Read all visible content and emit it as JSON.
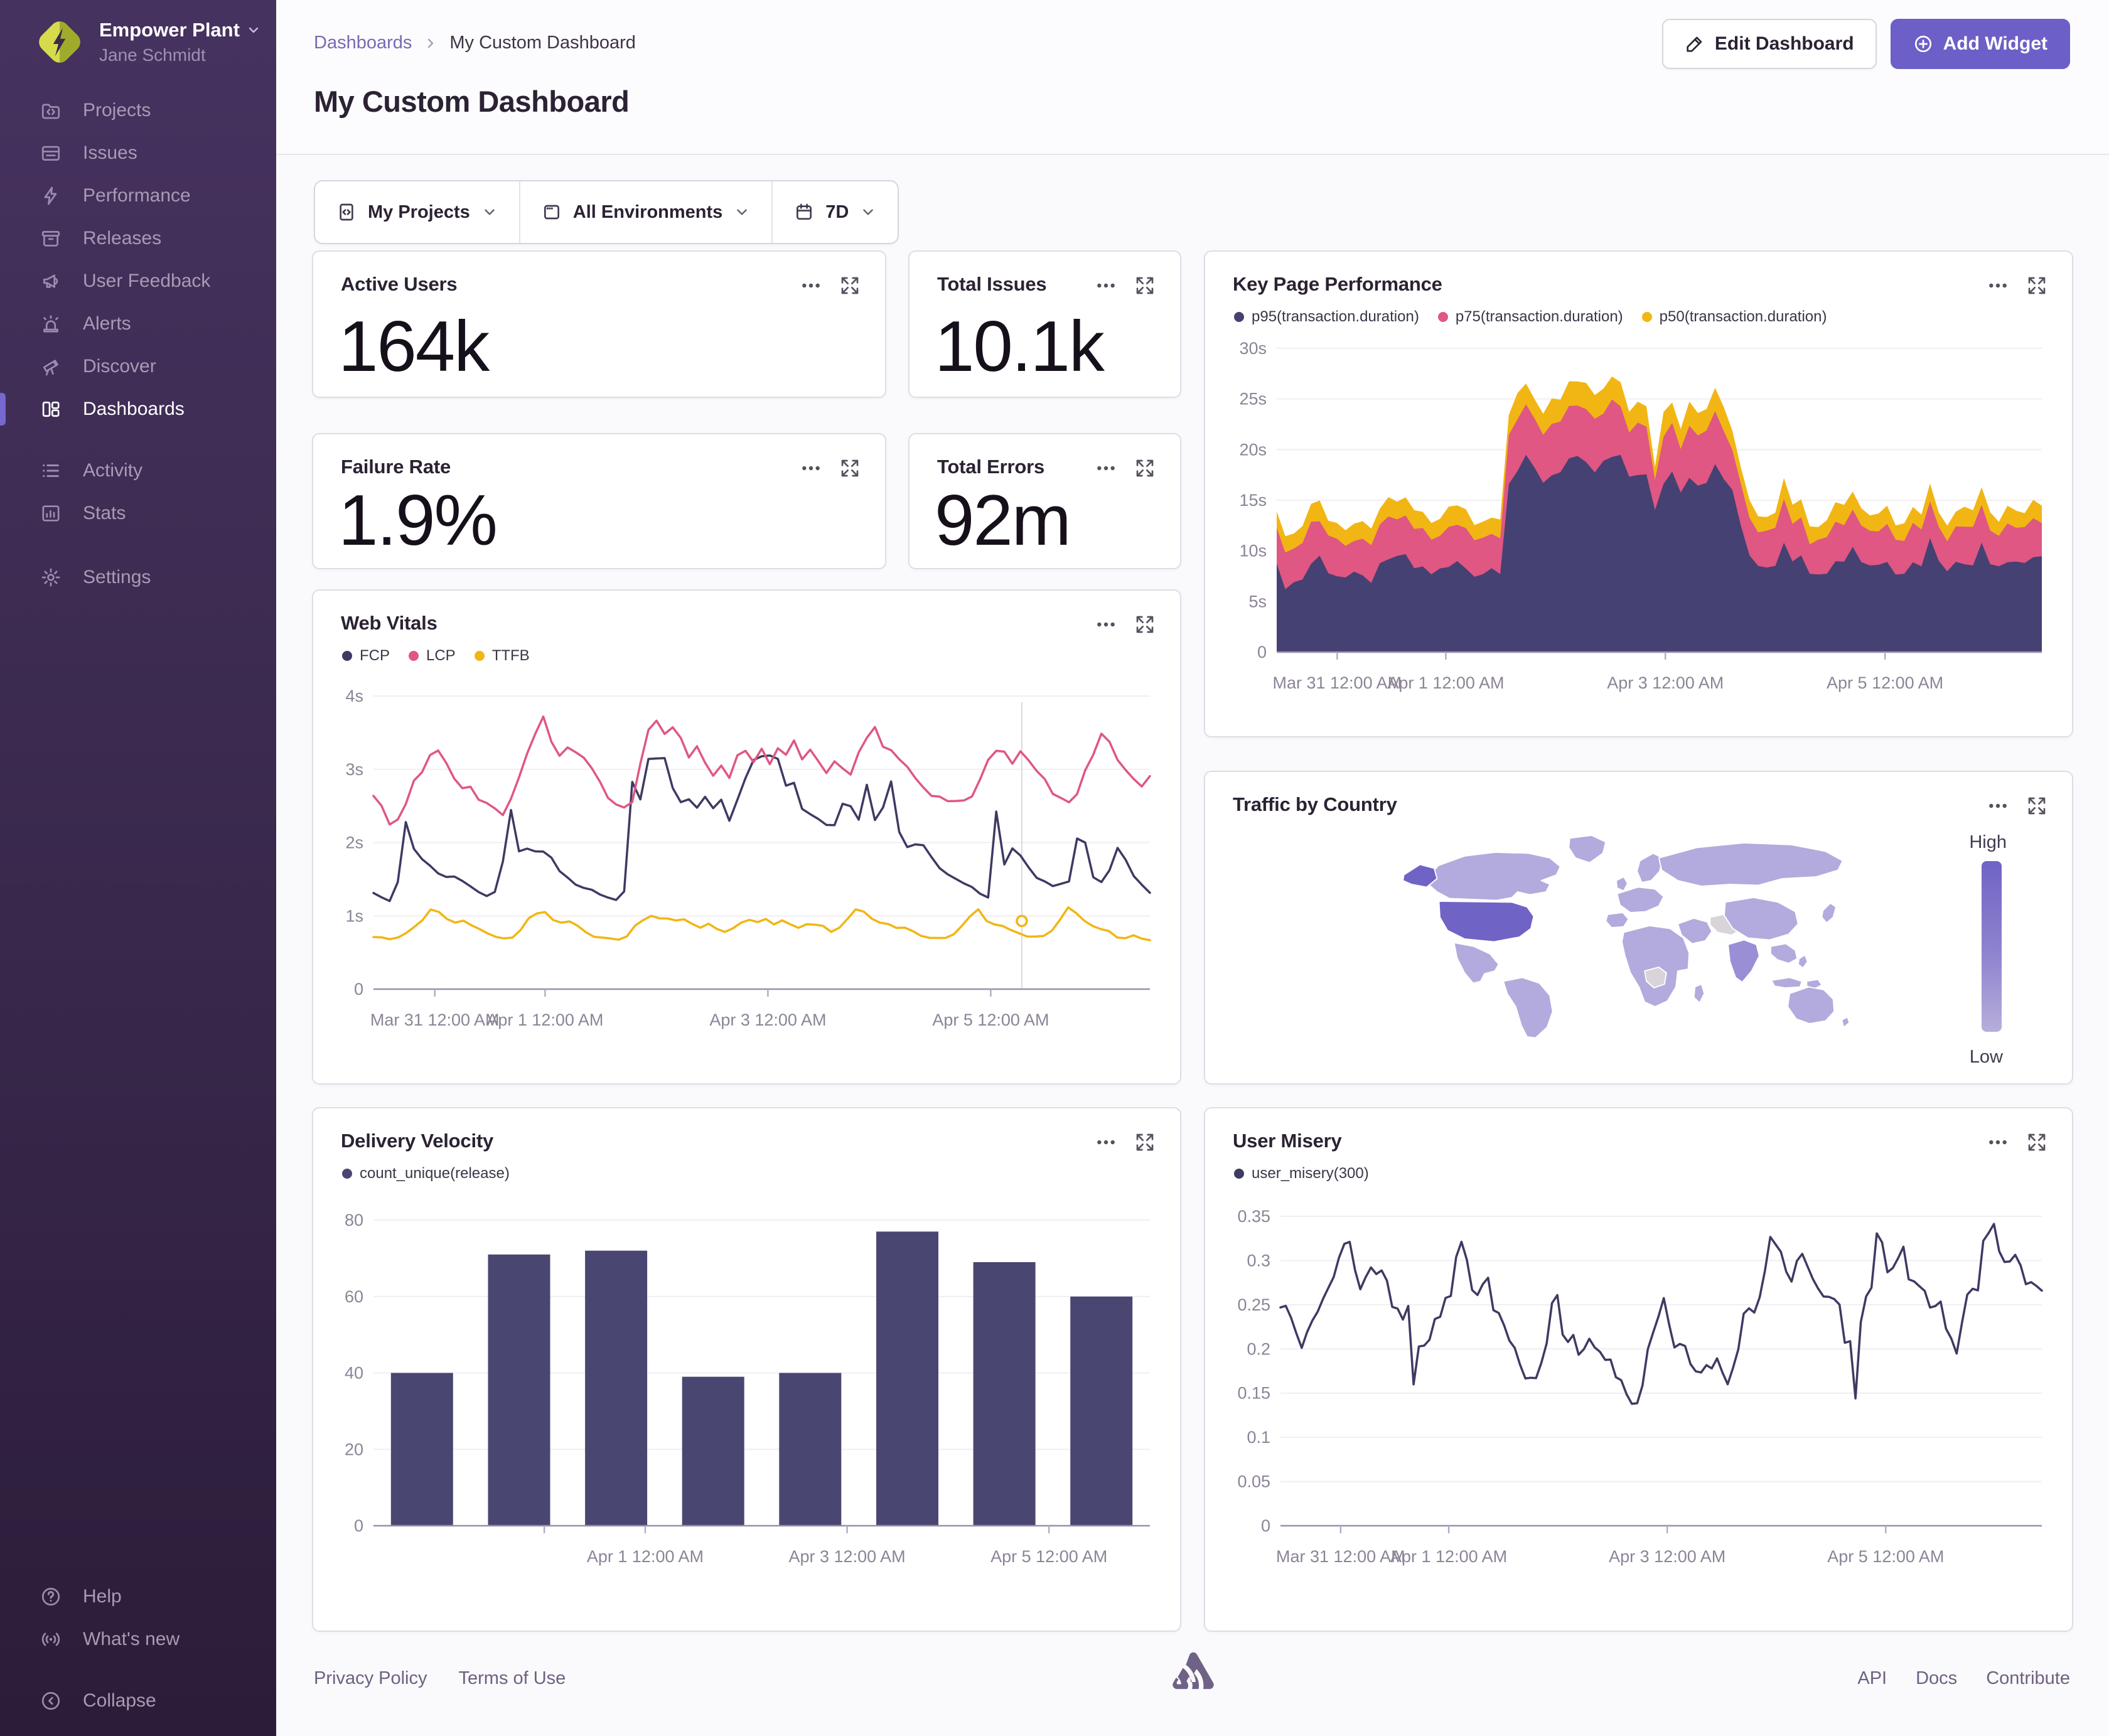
{
  "org": {
    "name": "Empower Plant",
    "user": "Jane Schmidt"
  },
  "sidebar": {
    "items": [
      {
        "label": "Projects",
        "icon": "projects-icon"
      },
      {
        "label": "Issues",
        "icon": "issues-icon"
      },
      {
        "label": "Performance",
        "icon": "performance-icon"
      },
      {
        "label": "Releases",
        "icon": "releases-icon"
      },
      {
        "label": "User Feedback",
        "icon": "user-feedback-icon"
      },
      {
        "label": "Alerts",
        "icon": "alerts-icon"
      },
      {
        "label": "Discover",
        "icon": "discover-icon"
      },
      {
        "label": "Dashboards",
        "icon": "dashboards-icon",
        "active": true
      },
      {
        "label": "Activity",
        "icon": "activity-icon"
      },
      {
        "label": "Stats",
        "icon": "stats-icon"
      },
      {
        "label": "Settings",
        "icon": "settings-icon"
      }
    ],
    "footer_items": [
      {
        "label": "Help",
        "icon": "help-icon"
      },
      {
        "label": "What's new",
        "icon": "broadcast-icon"
      },
      {
        "label": "Collapse",
        "icon": "collapse-icon"
      }
    ]
  },
  "breadcrumb": {
    "parent": "Dashboards",
    "current": "My Custom Dashboard"
  },
  "page_title": "My Custom Dashboard",
  "actions": {
    "edit": "Edit Dashboard",
    "add": "Add Widget"
  },
  "filters": {
    "projects": "My Projects",
    "environments": "All Environments",
    "date": "7D"
  },
  "widgets": {
    "stats": [
      {
        "title": "Active Users",
        "value": "164k"
      },
      {
        "title": "Total Issues",
        "value": "10.1k"
      },
      {
        "title": "Failure Rate",
        "value": "1.9%"
      },
      {
        "title": "Total Errors",
        "value": "92m"
      }
    ]
  },
  "map_legend": {
    "high": "High",
    "low": "Low"
  },
  "footer": {
    "privacy": "Privacy Policy",
    "terms": "Terms of Use",
    "api": "API",
    "docs": "Docs",
    "contribute": "Contribute"
  },
  "colors": {
    "accent": "#6C5FC7",
    "navy": "#454173",
    "pink": "#DF5782",
    "yellow": "#F1B613"
  },
  "chart_data": [
    {
      "type": "area",
      "stacked": true,
      "title": "Key Page Performance",
      "ylim": [
        0,
        30
      ],
      "yticks": [
        {
          "v": 0,
          "t": "0"
        },
        {
          "v": 5,
          "t": "5s"
        },
        {
          "v": 10,
          "t": "10s"
        },
        {
          "v": 15,
          "t": "15s"
        },
        {
          "v": 20,
          "t": "20s"
        },
        {
          "v": 25,
          "t": "25s"
        },
        {
          "v": 30,
          "t": "30s"
        }
      ],
      "xticks": [
        {
          "f": 0.079,
          "t": "Mar 31 12:00 AM"
        },
        {
          "f": 0.221,
          "t": "Apr 1 12:00 AM"
        },
        {
          "f": 0.508,
          "t": "Apr 3 12:00 AM"
        },
        {
          "f": 0.795,
          "t": "Apr 5 12:00 AM"
        }
      ],
      "series": [
        {
          "name": "p95(transaction.duration)",
          "color": "#454173",
          "jitter": 0.9,
          "values": [
            8.0,
            7.0,
            6.8,
            7.4,
            8.8,
            9.3,
            8.4,
            7.8,
            7.3,
            7.1,
            7.0,
            7.4,
            7.9,
            8.6,
            9.6,
            8.9,
            8.4,
            8.2,
            8.0,
            7.8,
            8.3,
            8.7,
            8.4,
            8.1,
            8.0,
            8.3,
            8.6,
            17.2,
            18.0,
            18.6,
            17.8,
            17.1,
            17.6,
            18.3,
            19.0,
            18.5,
            18.0,
            17.8,
            18.4,
            19.1,
            18.7,
            17.4,
            18.0,
            17.2,
            13.5,
            17.0,
            17.8,
            16.4,
            17.9,
            16.8,
            17.4,
            18.0,
            17.0,
            16.2,
            11.8,
            9.6,
            9.0,
            8.7,
            9.1,
            11.4,
            9.7,
            9.0,
            8.6,
            8.4,
            8.5,
            8.8,
            9.4,
            10.6,
            9.2,
            8.8,
            8.6,
            9.5,
            8.5,
            8.3,
            8.7,
            9.1,
            10.9,
            9.6,
            8.8,
            8.5,
            8.8,
            9.3,
            11.2,
            9.4,
            8.7,
            8.9,
            9.2,
            8.9,
            8.6,
            8.9
          ]
        },
        {
          "name": "p75(transaction.duration)",
          "color": "#DF5782",
          "jitter": 0.45,
          "values": [
            3.4,
            3.6,
            3.3,
            3.5,
            3.9,
            3.7,
            3.5,
            3.4,
            3.3,
            3.2,
            3.3,
            3.5,
            3.8,
            4.0,
            3.7,
            3.6,
            3.5,
            3.4,
            3.6,
            3.5,
            3.7,
            3.8,
            3.6,
            3.5,
            3.4,
            3.6,
            3.7,
            4.8,
            5.2,
            5.0,
            4.7,
            4.9,
            5.3,
            5.1,
            4.8,
            5.0,
            5.2,
            4.9,
            5.1,
            5.3,
            5.0,
            4.6,
            5.0,
            4.4,
            3.0,
            4.8,
            5.0,
            4.5,
            4.9,
            4.6,
            4.8,
            5.0,
            4.6,
            4.3,
            3.8,
            3.5,
            3.4,
            3.3,
            3.5,
            3.9,
            3.6,
            3.4,
            3.3,
            3.2,
            3.3,
            3.5,
            3.7,
            3.9,
            3.5,
            3.4,
            3.3,
            3.6,
            3.4,
            3.3,
            3.5,
            3.6,
            3.9,
            3.6,
            3.4,
            3.3,
            3.5,
            3.7,
            4.0,
            3.6,
            3.4,
            3.5,
            3.6,
            3.5,
            3.4,
            3.5
          ]
        },
        {
          "name": "p50(transaction.duration)",
          "color": "#F1B613",
          "jitter": 0.3,
          "values": [
            1.7,
            1.6,
            1.5,
            1.6,
            1.9,
            1.8,
            1.7,
            1.6,
            1.5,
            1.5,
            1.6,
            1.7,
            1.8,
            2.0,
            1.8,
            1.7,
            1.7,
            1.6,
            1.7,
            1.6,
            1.8,
            1.8,
            1.7,
            1.6,
            1.6,
            1.7,
            1.8,
            2.2,
            2.4,
            2.3,
            2.1,
            2.2,
            2.5,
            2.3,
            2.2,
            2.3,
            2.4,
            2.2,
            2.3,
            2.5,
            2.3,
            2.1,
            2.3,
            2.0,
            1.4,
            2.2,
            2.3,
            2.0,
            2.2,
            2.1,
            2.2,
            2.3,
            2.1,
            2.0,
            1.8,
            1.7,
            1.6,
            1.6,
            1.7,
            1.9,
            1.7,
            1.6,
            1.6,
            1.5,
            1.6,
            1.7,
            1.8,
            1.9,
            1.7,
            1.6,
            1.6,
            1.7,
            1.6,
            1.6,
            1.7,
            1.7,
            1.9,
            1.7,
            1.6,
            1.6,
            1.7,
            1.8,
            1.9,
            1.7,
            1.6,
            1.7,
            1.7,
            1.6,
            1.6,
            1.7
          ]
        }
      ]
    },
    {
      "type": "line",
      "title": "Web Vitals",
      "ylim": [
        0,
        4
      ],
      "yticks": [
        {
          "v": 0,
          "t": "0"
        },
        {
          "v": 1,
          "t": "1s"
        },
        {
          "v": 2,
          "t": "2s"
        },
        {
          "v": 3,
          "t": "3s"
        },
        {
          "v": 4,
          "t": "4s"
        }
      ],
      "xticks": [
        {
          "f": 0.079,
          "t": "Mar 31 12:00 AM"
        },
        {
          "f": 0.221,
          "t": "Apr 1 12:00 AM"
        },
        {
          "f": 0.508,
          "t": "Apr 3 12:00 AM"
        },
        {
          "f": 0.795,
          "t": "Apr 5 12:00 AM"
        }
      ],
      "hover": {
        "x": 0.835,
        "y": 0.93
      },
      "series": [
        {
          "name": "FCP",
          "color": "#3D3A63",
          "jitter": 0.05,
          "values": [
            1.3,
            1.25,
            1.2,
            1.45,
            2.25,
            1.95,
            1.75,
            1.65,
            1.6,
            1.55,
            1.5,
            1.45,
            1.4,
            1.3,
            1.28,
            1.3,
            1.7,
            2.4,
            1.9,
            1.95,
            1.85,
            1.9,
            1.75,
            1.6,
            1.5,
            1.45,
            1.4,
            1.35,
            1.3,
            1.25,
            1.2,
            1.35,
            2.85,
            2.6,
            3.1,
            3.15,
            3.15,
            2.7,
            2.6,
            2.55,
            2.5,
            2.65,
            2.45,
            2.55,
            2.3,
            2.6,
            2.9,
            3.15,
            3.15,
            3.15,
            3.1,
            2.75,
            2.8,
            2.5,
            2.35,
            2.3,
            2.25,
            2.2,
            2.5,
            2.45,
            2.3,
            2.75,
            2.35,
            2.45,
            2.8,
            2.1,
            1.95,
            2.0,
            1.95,
            1.8,
            1.65,
            1.55,
            1.5,
            1.45,
            1.35,
            1.3,
            1.28,
            2.45,
            1.75,
            1.9,
            1.8,
            1.65,
            1.55,
            1.5,
            1.45,
            1.4,
            1.5,
            2.05,
            1.95,
            1.55,
            1.45,
            1.65,
            1.95,
            1.75,
            1.55,
            1.4,
            1.3
          ]
        },
        {
          "name": "LCP",
          "color": "#DF5782",
          "jitter": 0.05,
          "values": [
            2.65,
            2.5,
            2.25,
            2.3,
            2.55,
            2.8,
            3.0,
            3.2,
            3.25,
            3.05,
            2.85,
            2.75,
            2.8,
            2.6,
            2.55,
            2.45,
            2.35,
            2.6,
            2.9,
            3.2,
            3.45,
            3.7,
            3.35,
            3.2,
            3.3,
            3.25,
            3.15,
            3.05,
            2.8,
            2.65,
            2.55,
            2.5,
            2.55,
            3.1,
            3.5,
            3.65,
            3.45,
            3.55,
            3.4,
            3.2,
            3.3,
            3.1,
            2.95,
            3.05,
            2.9,
            3.15,
            3.3,
            3.1,
            3.25,
            3.05,
            3.3,
            3.2,
            3.35,
            3.15,
            3.3,
            3.1,
            2.95,
            3.15,
            3.05,
            2.9,
            3.2,
            3.4,
            3.55,
            3.35,
            3.25,
            3.1,
            3.0,
            2.9,
            2.75,
            2.65,
            2.6,
            2.55,
            2.6,
            2.55,
            2.65,
            2.9,
            3.15,
            3.3,
            3.25,
            3.1,
            3.2,
            3.15,
            3.0,
            2.85,
            2.7,
            2.6,
            2.55,
            2.7,
            2.95,
            3.2,
            3.45,
            3.35,
            3.15,
            3.0,
            2.85,
            2.8,
            2.9
          ]
        },
        {
          "name": "TTFB",
          "color": "#F1B613",
          "jitter": 0.02,
          "values": [
            0.72,
            0.7,
            0.68,
            0.7,
            0.75,
            0.85,
            0.95,
            1.08,
            1.05,
            0.95,
            0.9,
            0.92,
            0.88,
            0.8,
            0.75,
            0.72,
            0.7,
            0.72,
            0.8,
            0.95,
            1.05,
            1.04,
            0.95,
            0.9,
            0.92,
            0.85,
            0.78,
            0.72,
            0.7,
            0.68,
            0.66,
            0.72,
            0.85,
            0.95,
            1.0,
            0.97,
            0.95,
            0.93,
            0.95,
            0.9,
            0.85,
            0.88,
            0.82,
            0.78,
            0.85,
            0.92,
            0.95,
            0.93,
            0.95,
            0.9,
            0.92,
            0.88,
            0.85,
            0.9,
            0.88,
            0.85,
            0.8,
            0.82,
            0.95,
            1.08,
            1.05,
            0.95,
            0.9,
            0.88,
            0.85,
            0.82,
            0.78,
            0.72,
            0.7,
            0.68,
            0.7,
            0.75,
            0.85,
            1.0,
            1.08,
            0.95,
            0.88,
            0.85,
            0.8,
            0.75,
            0.72,
            0.7,
            0.72,
            0.78,
            0.95,
            1.1,
            1.02,
            0.95,
            0.88,
            0.82,
            0.78,
            0.72,
            0.7,
            0.72,
            0.7,
            0.68
          ]
        }
      ]
    },
    {
      "type": "map",
      "title": "Traffic by Country",
      "legend": {
        "high": "High",
        "low": "Low"
      },
      "highlight_countries": [
        "United States",
        "Alaska"
      ],
      "mid_countries": [
        "India"
      ],
      "no_data_countries": [
        "Iran",
        "DR Congo"
      ]
    },
    {
      "type": "bar",
      "title": "Delivery Velocity",
      "ylim": [
        0,
        80
      ],
      "yticks": [
        {
          "v": 0,
          "t": "0"
        },
        {
          "v": 20,
          "t": "20"
        },
        {
          "v": 40,
          "t": "40"
        },
        {
          "v": 60,
          "t": "60"
        },
        {
          "v": 80,
          "t": "80"
        }
      ],
      "xticks": [
        {
          "f": 0.22,
          "t": ""
        },
        {
          "f": 0.35,
          "t": "Apr 1 12:00 AM"
        },
        {
          "f": 0.61,
          "t": "Apr 3 12:00 AM"
        },
        {
          "f": 0.87,
          "t": "Apr 5 12:00 AM"
        }
      ],
      "series": [
        {
          "name": "count_unique(release)",
          "color": "#4A4672",
          "values": [
            40,
            71,
            72,
            39,
            40,
            77,
            69,
            60
          ]
        }
      ]
    },
    {
      "type": "line",
      "title": "User Misery",
      "ylim": [
        0,
        0.35
      ],
      "yticks": [
        {
          "v": 0,
          "t": "0"
        },
        {
          "v": 0.05,
          "t": "0.05"
        },
        {
          "v": 0.1,
          "t": "0.1"
        },
        {
          "v": 0.15,
          "t": "0.15"
        },
        {
          "v": 0.2,
          "t": "0.2"
        },
        {
          "v": 0.25,
          "t": "0.25"
        },
        {
          "v": 0.3,
          "t": "0.3"
        },
        {
          "v": 0.35,
          "t": "0.35"
        }
      ],
      "xticks": [
        {
          "f": 0.079,
          "t": "Mar 31 12:00 AM"
        },
        {
          "f": 0.221,
          "t": "Apr 1 12:00 AM"
        },
        {
          "f": 0.508,
          "t": "Apr 3 12:00 AM"
        },
        {
          "f": 0.795,
          "t": "Apr 5 12:00 AM"
        }
      ],
      "series": [
        {
          "name": "user_misery(300)",
          "color": "#3D3A63",
          "jitter": 0.004,
          "values": [
            0.25,
            0.245,
            0.235,
            0.22,
            0.205,
            0.215,
            0.235,
            0.24,
            0.255,
            0.27,
            0.285,
            0.3,
            0.32,
            0.318,
            0.29,
            0.27,
            0.285,
            0.295,
            0.285,
            0.29,
            0.275,
            0.25,
            0.245,
            0.235,
            0.245,
            0.16,
            0.2,
            0.2,
            0.21,
            0.23,
            0.24,
            0.255,
            0.26,
            0.3,
            0.325,
            0.3,
            0.27,
            0.26,
            0.275,
            0.28,
            0.245,
            0.24,
            0.23,
            0.21,
            0.2,
            0.185,
            0.167,
            0.17,
            0.165,
            0.185,
            0.21,
            0.255,
            0.26,
            0.22,
            0.21,
            0.215,
            0.19,
            0.2,
            0.215,
            0.205,
            0.195,
            0.185,
            0.19,
            0.165,
            0.162,
            0.148,
            0.14,
            0.138,
            0.16,
            0.2,
            0.22,
            0.235,
            0.258,
            0.23,
            0.205,
            0.205,
            0.2,
            0.185,
            0.172,
            0.175,
            0.18,
            0.175,
            0.19,
            0.17,
            0.162,
            0.18,
            0.2,
            0.24,
            0.245,
            0.24,
            0.255,
            0.29,
            0.328,
            0.315,
            0.31,
            0.285,
            0.28,
            0.3,
            0.308,
            0.295,
            0.275,
            0.27,
            0.262,
            0.255,
            0.26,
            0.25,
            0.21,
            0.205,
            0.145,
            0.23,
            0.26,
            0.27,
            0.333,
            0.32,
            0.29,
            0.295,
            0.305,
            0.315,
            0.28,
            0.275,
            0.27,
            0.262,
            0.25,
            0.252,
            0.255,
            0.22,
            0.215,
            0.192,
            0.23,
            0.26,
            0.265,
            0.27,
            0.32,
            0.33,
            0.345,
            0.31,
            0.295,
            0.3,
            0.305,
            0.295,
            0.275,
            0.272,
            0.27,
            0.268
          ]
        }
      ]
    }
  ]
}
